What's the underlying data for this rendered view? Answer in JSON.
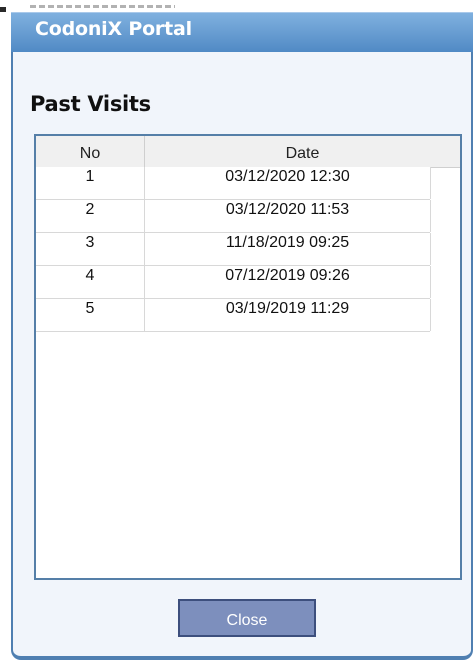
{
  "window": {
    "title": "CodoniX Portal"
  },
  "heading": "Past Visits",
  "table": {
    "columns": [
      "No",
      "Date"
    ],
    "rows": [
      {
        "no": "1",
        "date": "03/12/2020 12:30"
      },
      {
        "no": "2",
        "date": "03/12/2020 11:53"
      },
      {
        "no": "3",
        "date": "11/18/2019 09:25"
      },
      {
        "no": "4",
        "date": "07/12/2019 09:26"
      },
      {
        "no": "5",
        "date": "03/19/2019 11:29"
      }
    ]
  },
  "buttons": {
    "close_label": "Close"
  },
  "colors": {
    "titlebar": "#6a9fd3",
    "frame_border": "#4f7fb1",
    "body_bg": "#f1f5fb",
    "button_bg": "#7d8fbd"
  }
}
